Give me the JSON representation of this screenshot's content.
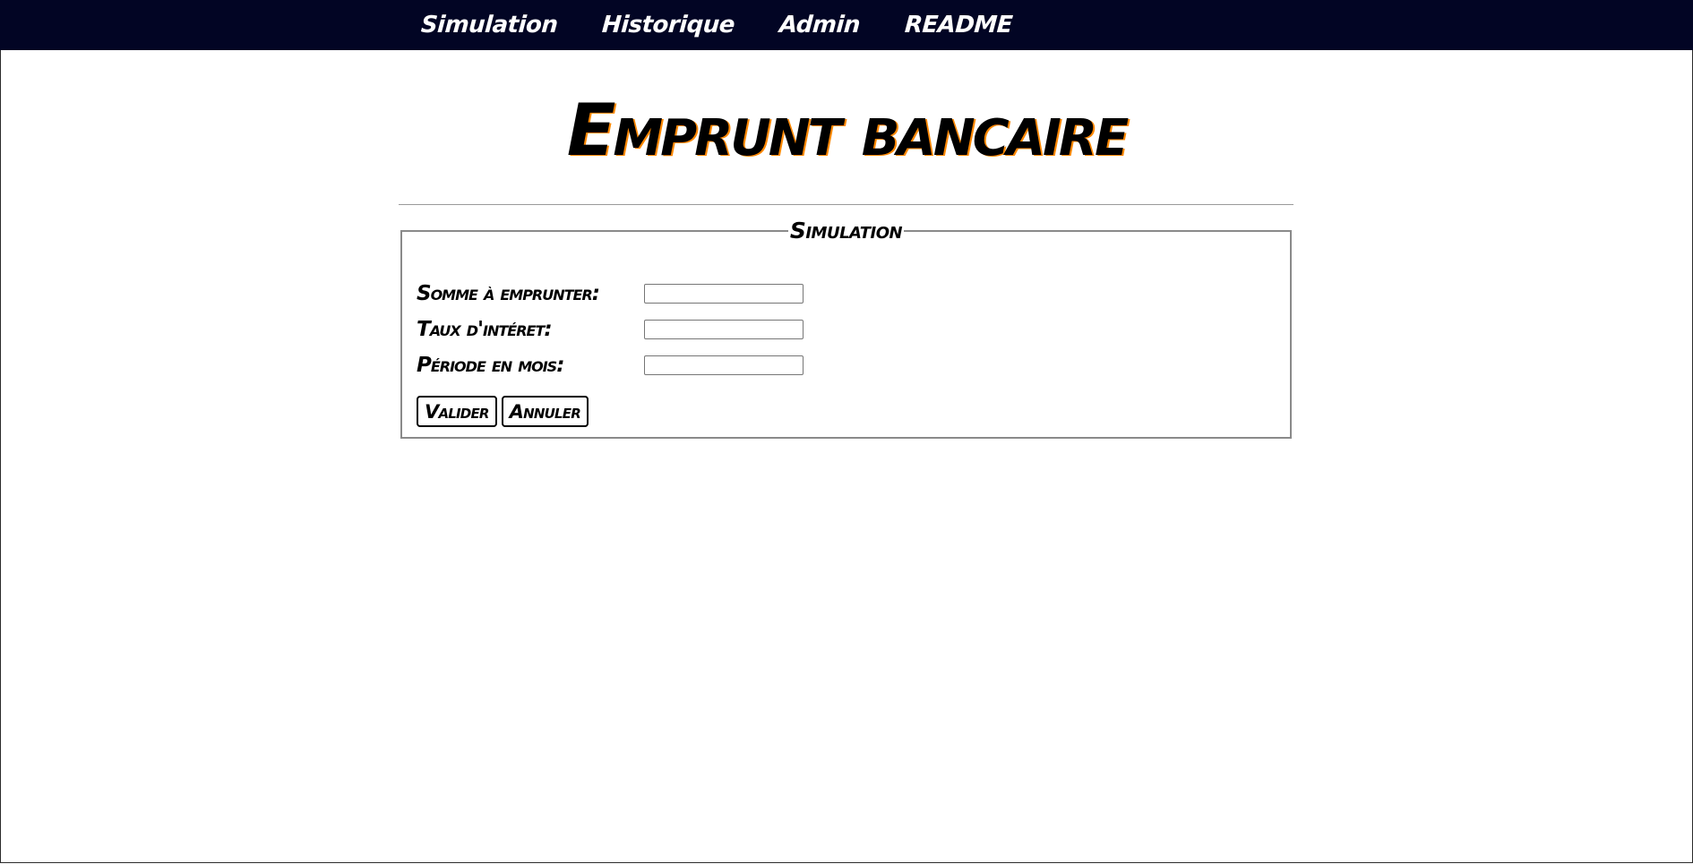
{
  "nav": {
    "items": [
      {
        "label": "Simulation"
      },
      {
        "label": "Historique"
      },
      {
        "label": "Admin"
      },
      {
        "label": "README"
      }
    ]
  },
  "header": {
    "title": "Emprunt bancaire"
  },
  "simulation": {
    "legend": "Simulation",
    "fields": [
      {
        "label": "Somme à emprunter:",
        "value": ""
      },
      {
        "label": "Taux d'intéret:",
        "value": ""
      },
      {
        "label": "Période en mois:",
        "value": ""
      }
    ],
    "submit_label": "Valider",
    "reset_label": "Annuler"
  },
  "colors": {
    "navbar_bg": "#020524",
    "nav_text": "#ffffff",
    "title_shadow": "#ff8800"
  }
}
